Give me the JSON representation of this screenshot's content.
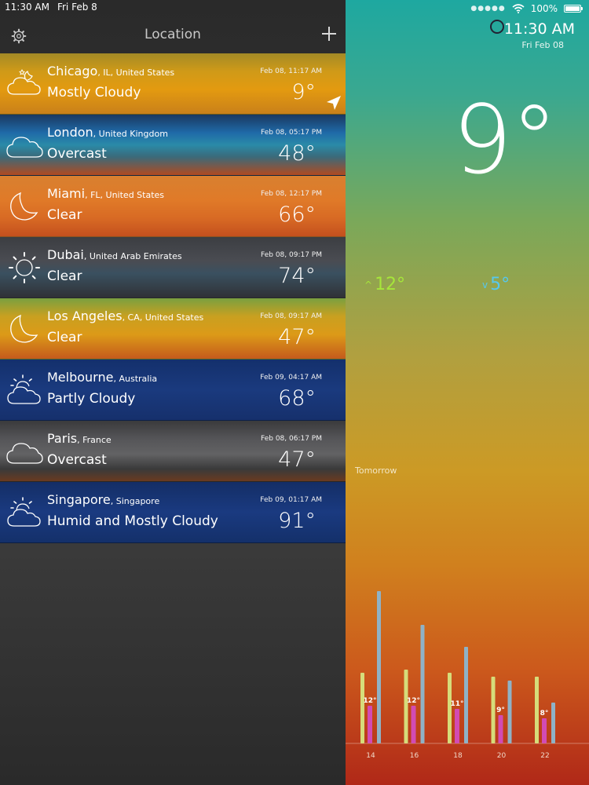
{
  "status": {
    "time": "11:30 AM",
    "date": "Fri Feb 8",
    "battery": "100%"
  },
  "sidebar": {
    "title": "Location"
  },
  "locations": [
    {
      "key": "chicago",
      "city": "Chicago",
      "region": ", IL, United States",
      "condition": "Mostly Cloudy",
      "time": "Feb 08, 11:17 AM",
      "temp": "9°",
      "icon": "partly-cloudy-night-icon"
    },
    {
      "key": "london",
      "city": "London",
      "region": ", United Kingdom",
      "condition": "Overcast",
      "time": "Feb 08, 05:17 PM",
      "temp": "48°",
      "icon": "cloud-icon"
    },
    {
      "key": "miami",
      "city": "Miami",
      "region": ", FL, United States",
      "condition": "Clear",
      "time": "Feb 08, 12:17 PM",
      "temp": "66°",
      "icon": "moon-icon"
    },
    {
      "key": "dubai",
      "city": "Dubai",
      "region": ", United Arab Emirates",
      "condition": "Clear",
      "time": "Feb 08, 09:17 PM",
      "temp": "74°",
      "icon": "sun-icon"
    },
    {
      "key": "la",
      "city": "Los Angeles",
      "region": ", CA, United States",
      "condition": "Clear",
      "time": "Feb 08, 09:17 AM",
      "temp": "47°",
      "icon": "moon-icon"
    },
    {
      "key": "melbourne",
      "city": "Melbourne",
      "region": ", Australia",
      "condition": "Partly Cloudy",
      "time": "Feb 09, 04:17 AM",
      "temp": "68°",
      "icon": "partly-cloudy-icon"
    },
    {
      "key": "paris",
      "city": "Paris",
      "region": ", France",
      "condition": "Overcast",
      "time": "Feb 08, 06:17 PM",
      "temp": "47°",
      "icon": "cloud-icon"
    },
    {
      "key": "singapore",
      "city": "Singapore",
      "region": ", Singapore",
      "condition": "Humid and Mostly Cloudy",
      "time": "Feb 09, 01:17 AM",
      "temp": "91°",
      "icon": "partly-cloudy-icon"
    }
  ],
  "main": {
    "time": "11:30 AM",
    "date": "Fri Feb 08",
    "temp": "9°",
    "high": "12°",
    "low": "5°",
    "tomorrow_label": "Tomorrow"
  },
  "chart_data": {
    "type": "bar",
    "categories": [
      "14",
      "16",
      "18",
      "20",
      "22"
    ],
    "series": [
      {
        "values": [
          12,
          12,
          11,
          9,
          8
        ],
        "labels": [
          "12°",
          "12°",
          "11°",
          "9°",
          "8°"
        ],
        "color": "#d24bb4"
      }
    ]
  },
  "colors": {
    "high": "#a6e63a",
    "low": "#56c8ee",
    "accent_bar": "#d24bb4",
    "bar_light": "#d6dc7a",
    "bar_blue": "#8fb2c6"
  }
}
